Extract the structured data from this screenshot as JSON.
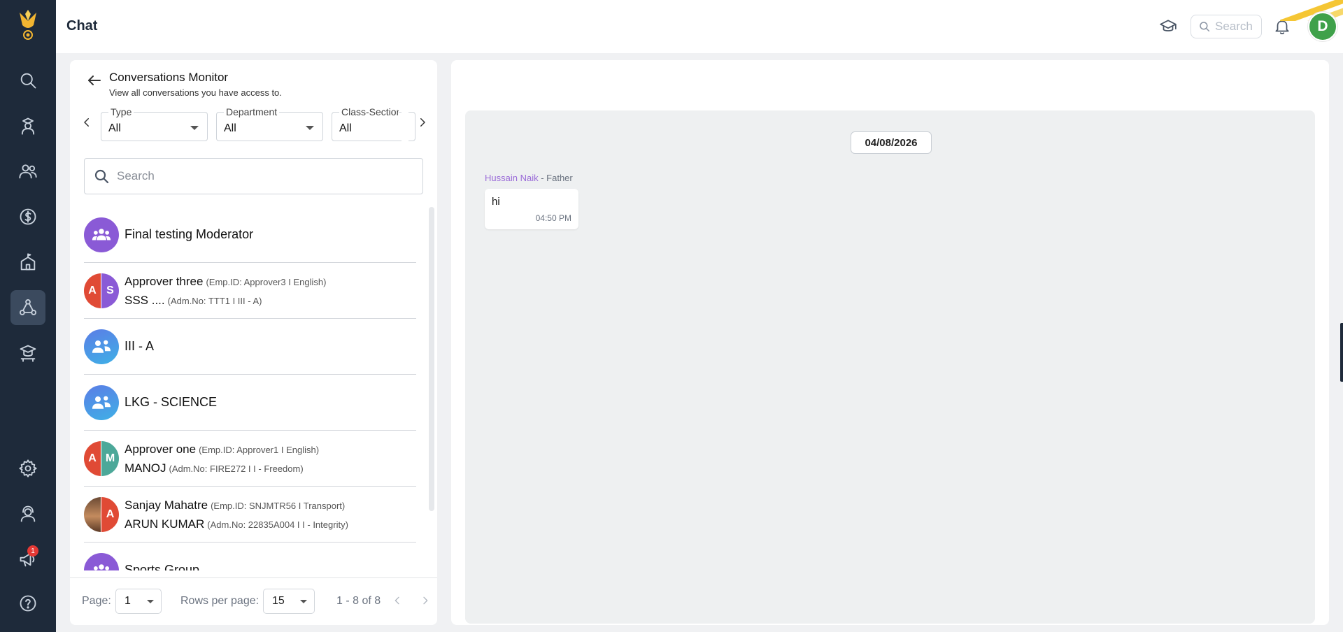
{
  "header": {
    "title": "Chat",
    "search_placeholder": "Search",
    "avatar_initial": "D"
  },
  "sidebar": {
    "items": [
      {
        "name": "search",
        "icon": "search-icon"
      },
      {
        "name": "student",
        "icon": "student-icon"
      },
      {
        "name": "people",
        "icon": "people-icon"
      },
      {
        "name": "fees",
        "icon": "dollar-icon"
      },
      {
        "name": "school",
        "icon": "school-icon"
      },
      {
        "name": "chat",
        "icon": "chat-network-icon",
        "active": true
      },
      {
        "name": "classroom",
        "icon": "classroom-icon"
      },
      {
        "name": "settings",
        "icon": "gear-icon"
      },
      {
        "name": "support",
        "icon": "support-agent-icon"
      },
      {
        "name": "announcements",
        "icon": "megaphone-icon",
        "badge": "1"
      },
      {
        "name": "help",
        "icon": "help-icon"
      }
    ]
  },
  "monitor": {
    "title": "Conversations Monitor",
    "subtitle": "View all conversations you have access to.",
    "filters": [
      {
        "label": "Type",
        "value": "All"
      },
      {
        "label": "Department",
        "value": "All"
      },
      {
        "label": "Class-Section",
        "value": "All"
      }
    ],
    "search_placeholder": "Search",
    "conversations": [
      {
        "kind": "group",
        "title": "Final testing Moderator"
      },
      {
        "kind": "pair",
        "initials": [
          "A",
          "S"
        ],
        "line1_name": "Approver three",
        "line1_meta": "(Emp.ID: Approver3  I  English)",
        "line2_name": "SSS ....",
        "line2_meta": "(Adm.No: TTT1  I  III - A)"
      },
      {
        "kind": "class",
        "title": "III - A"
      },
      {
        "kind": "class",
        "title": "LKG - SCIENCE"
      },
      {
        "kind": "pair",
        "initials": [
          "A",
          "M"
        ],
        "line1_name": "Approver one",
        "line1_meta": "(Emp.ID: Approver1  I  English)",
        "line2_name": "MANOJ",
        "line2_meta": "(Adm.No: FIRE272  I  I - Freedom)"
      },
      {
        "kind": "pair-photo",
        "initials": [
          "",
          "A"
        ],
        "line1_name": "Sanjay Mahatre",
        "line1_meta": "(Emp.ID: SNJMTR56  I  Transport)",
        "line2_name": "ARUN KUMAR",
        "line2_meta": "(Adm.No: 22835A004  I  I - Integrity)"
      },
      {
        "kind": "group",
        "title": "Sports Group"
      }
    ],
    "pagination": {
      "page_label": "Page:",
      "page_value": "1",
      "rows_label": "Rows per page:",
      "rows_value": "15",
      "range": "1 - 8 of 8"
    }
  },
  "chat": {
    "date": "04/08/2026",
    "messages": [
      {
        "sender": "Hussain Naik",
        "relation": "- Father",
        "text": "hi",
        "time": "04:50 PM"
      }
    ]
  },
  "colors": {
    "rail": "#1e2a3a",
    "accent_purple": "#8a5ad6",
    "avatar_green": "#3fa14a",
    "sender_name": "#9a6bd8"
  }
}
